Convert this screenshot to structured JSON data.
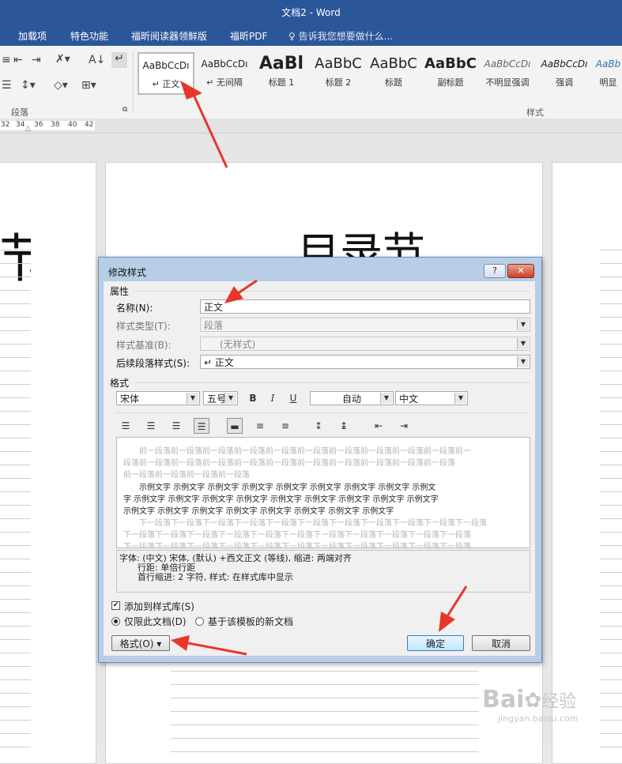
{
  "window": {
    "title": "文档2 - Word"
  },
  "tabs": [
    "加载项",
    "特色功能",
    "福昕阅读器领鲜版",
    "福昕PDF"
  ],
  "tell_me": "告诉我您想要做什么...",
  "ribbon": {
    "paragraph_group_label": "段落",
    "styles_group_label": "样式",
    "styles": [
      {
        "preview": "AaBbCcDı",
        "name": "↵ 正文",
        "selected": true
      },
      {
        "preview": "AaBbCcDı",
        "name": "↵ 无间隔"
      },
      {
        "preview": "AaBl",
        "name": "标题 1"
      },
      {
        "preview": "AaBbC",
        "name": "标题 2"
      },
      {
        "preview": "AaBbC",
        "name": "标题"
      },
      {
        "preview": "AaBbC",
        "name": "副标题"
      },
      {
        "preview": "AaBbCcDı",
        "name": "不明显强调"
      },
      {
        "preview": "AaBbCcDı",
        "name": "强调"
      },
      {
        "preview": "AaBb",
        "name": "明显"
      }
    ]
  },
  "ruler": {
    "ticks": [
      "32",
      "34",
      "36",
      "38",
      "40",
      "42"
    ]
  },
  "document": {
    "left_heading": "节",
    "center_heading": "目录节"
  },
  "dialog": {
    "title": "修改样式",
    "help_label": "?",
    "close_label": "✕",
    "properties_label": "属性",
    "name_label": "名称(N):",
    "name_value": "正文",
    "style_type_label": "样式类型(T):",
    "style_type_value": "段落",
    "based_on_label": "样式基准(B):",
    "based_on_value": "(无样式)",
    "following_label": "后续段落样式(S):",
    "following_value": "↵ 正文",
    "format_label": "格式",
    "font_value": "宋体",
    "size_value": "五号",
    "bold_label": "B",
    "italic_label": "I",
    "underline_label": "U",
    "color_value": "自动",
    "script_value": "中文",
    "preview": {
      "prev_lines": [
        "前一段落前一段落前一段落前一段落前一段落前一段落前一段落前一段落前一段落前一段落前一",
        "段落前一段落前一段落前一段落前一段落前一段落前一段落前一段落前一段落前一段落前一段落",
        "前一段落前一段落前一段落前一段落"
      ],
      "sample_lines": [
        "示例文字  示例文字  示例文字  示例文字  示例文字  示例文字  示例文字  示例文字  示例文",
        "字  示例文字  示例文字  示例文字  示例文字  示例文字  示例文字  示例文字  示例文字  示例文字",
        "示例文字  示例文字  示例文字  示例文字  示例文字  示例文字  示例文字  示例文字"
      ],
      "next_lines": [
        "下一段落下一段落下一段落下一段落下一段落下一段落下一段落下一段落下一段落下一段落下一段落",
        "下一段落下一段落下一段落下一段落下一段落下一段落下一段落下一段落下一段落下一段落下一段落",
        "下一段落下一段落下一段落下一段落下一段落下一段落下一段落下一段落下一段落下一段落下一段落"
      ]
    },
    "description_lines": [
      "字体: (中文) 宋体, (默认) +西文正文 (等线), 缩进: 两端对齐",
      "行距: 单倍行距",
      "首行缩进:  2 字符, 样式: 在样式库中显示"
    ],
    "add_to_gallery_label": "添加到样式库(S)",
    "add_to_gallery_checked": true,
    "only_this_doc_label": "仅限此文档(D)",
    "new_docs_label": "基于该模板的新文档",
    "format_button_label": "格式(O) ▾",
    "ok_label": "确定",
    "cancel_label": "取消"
  },
  "watermark": {
    "brand": "Bai",
    "brand_suffix": "经验",
    "url": "jingyan.baidu.com"
  },
  "colors": {
    "word_blue": "#2b579a",
    "arrow_red": "#e8362b",
    "dialog_frame": "#b8cde6"
  }
}
